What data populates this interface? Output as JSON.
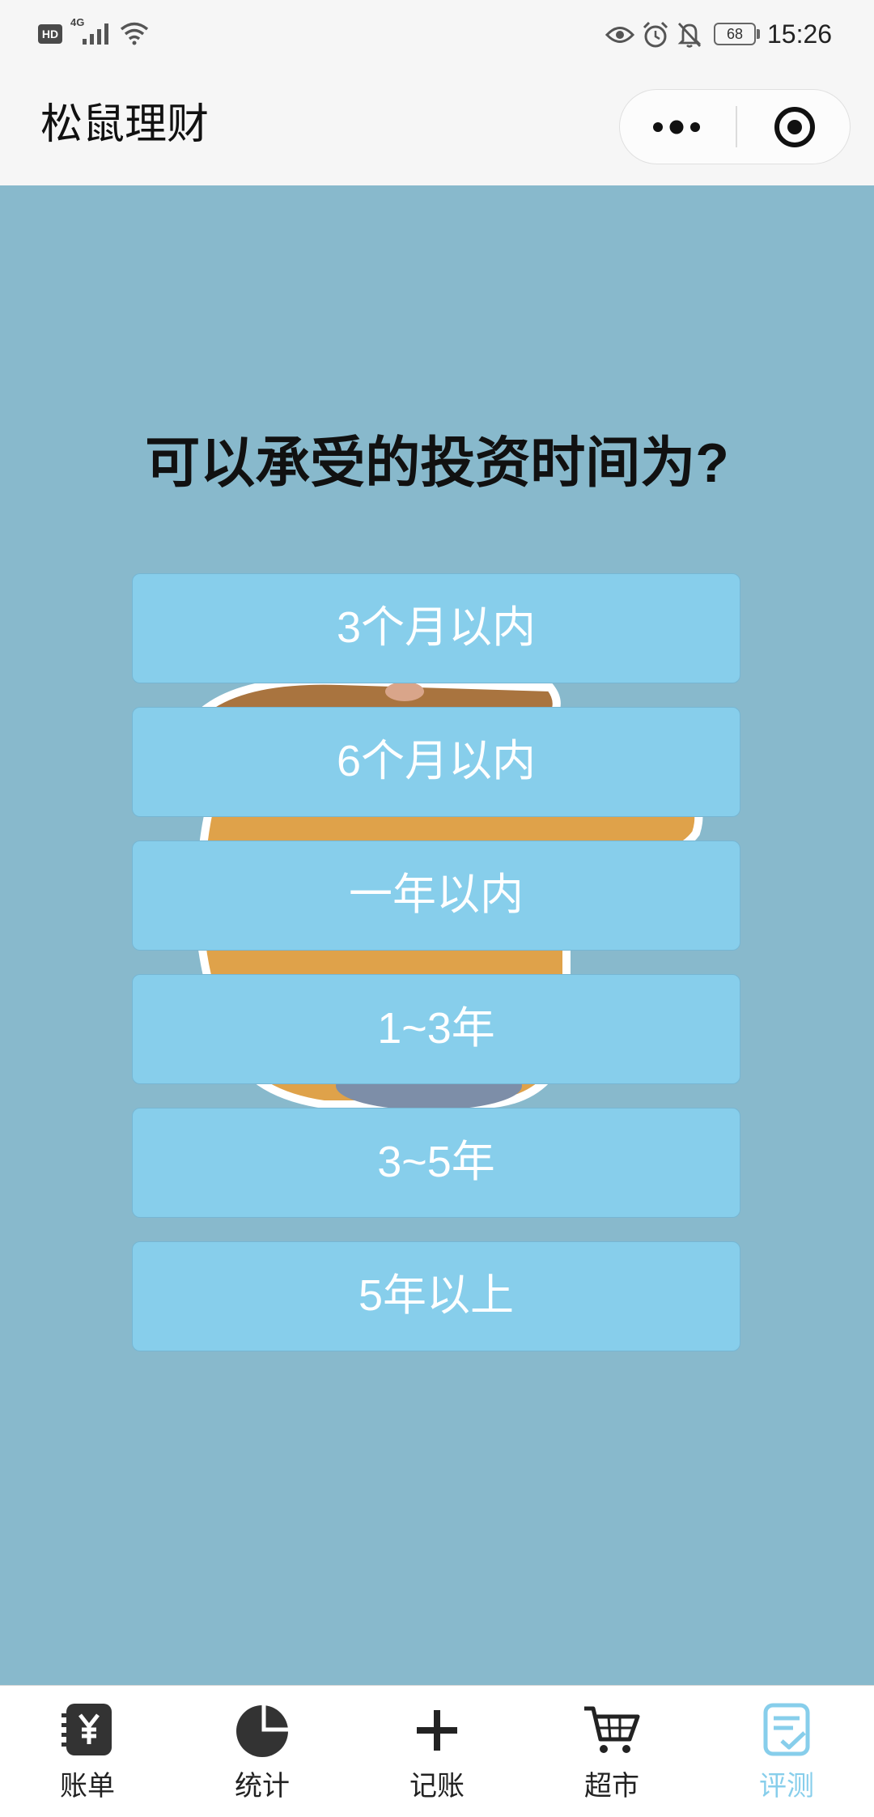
{
  "status_bar": {
    "hd_badge": "HD",
    "network": "4G",
    "battery": "68",
    "time": "15:26",
    "icons": [
      "signal-icon",
      "wifi-icon",
      "eye-icon",
      "alarm-icon",
      "bell-off-icon"
    ]
  },
  "nav": {
    "title": "松鼠理财",
    "capsule": {
      "more_icon": "more-dots-icon",
      "close_icon": "target-icon"
    }
  },
  "question": {
    "text": "可以承受的投资时间为?",
    "options": [
      "3个月以内",
      "6个月以内",
      "一年以内",
      "1~3年",
      "3~5年",
      "5年以上"
    ]
  },
  "tabbar": {
    "items": [
      {
        "label": "账单",
        "icon": "bill-icon",
        "active": false
      },
      {
        "label": "统计",
        "icon": "pie-chart-icon",
        "active": false
      },
      {
        "label": "记账",
        "icon": "plus-icon",
        "active": false
      },
      {
        "label": "超市",
        "icon": "cart-icon",
        "active": false
      },
      {
        "label": "评测",
        "icon": "assessment-icon",
        "active": true
      }
    ]
  },
  "colors": {
    "background": "#88b9cc",
    "option": "#87ceeb",
    "tab_active": "#87ceeb"
  }
}
